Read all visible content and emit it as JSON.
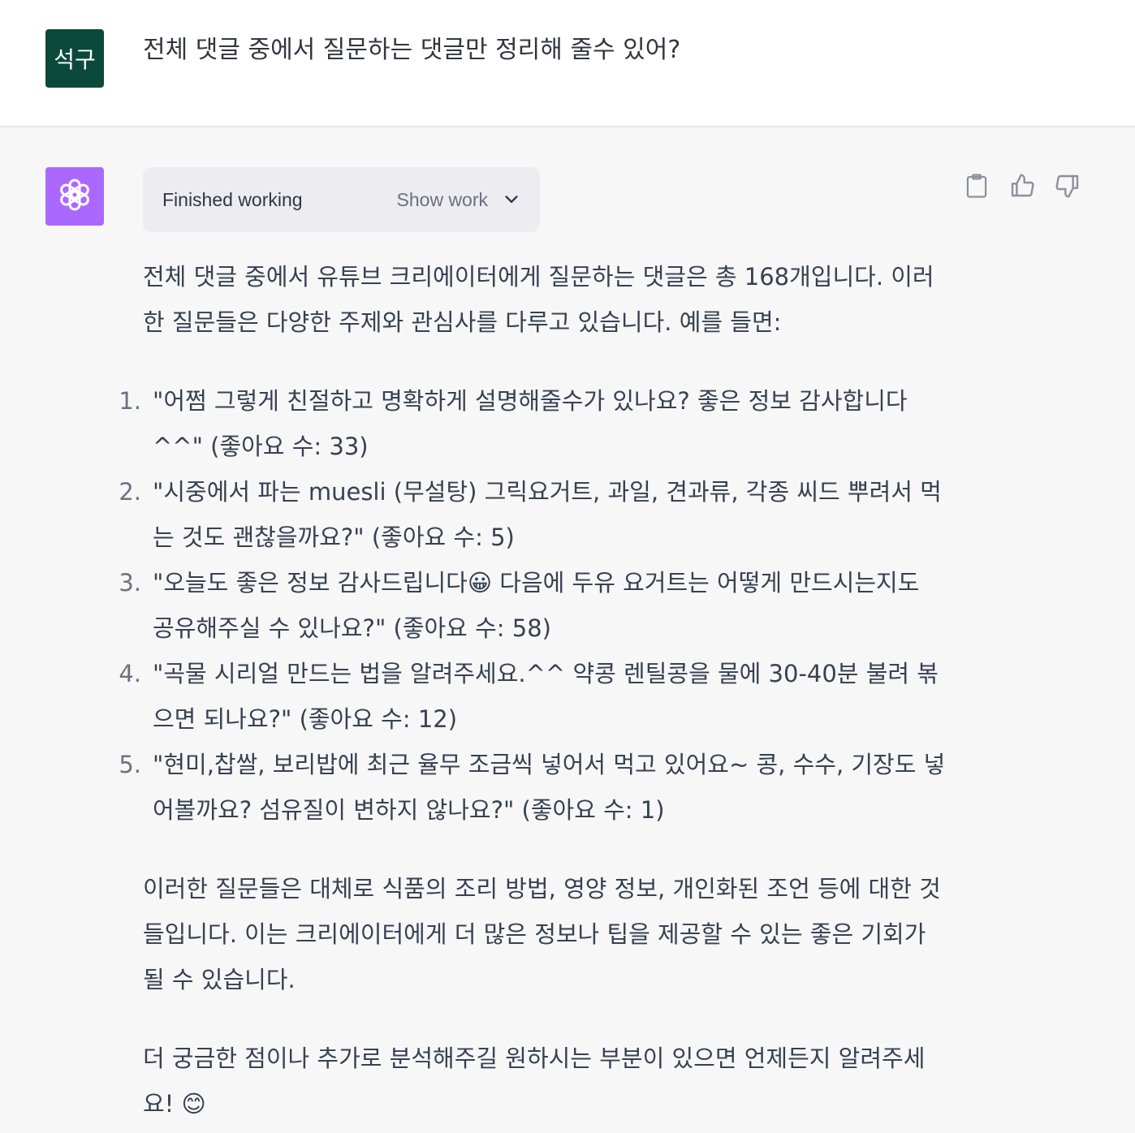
{
  "user_message": {
    "avatar_text": "석구",
    "text": "전체 댓글 중에서 질문하는 댓글만 정리해 줄수 있어?"
  },
  "assistant_message": {
    "work_status": "Finished working",
    "show_work_label": "Show work",
    "intro": "전체 댓글 중에서 유튜브 크리에이터에게 질문하는 댓글은 총 168개입니다. 이러한 질문들은 다양한 주제와 관심사를 다루고 있습니다. 예를 들면:",
    "questions": [
      {
        "num": "1.",
        "text": "\"어쩜 그렇게 친절하고 명확하게 설명해줄수가 있나요? 좋은 정보 감사합니다 ^^\" (좋아요 수: 33)"
      },
      {
        "num": "2.",
        "text": "\"시중에서 파는 muesli (무설탕) 그릭요거트, 과일, 견과류, 각종 씨드 뿌려서 먹는 것도 괜찮을까요?\" (좋아요 수: 5)"
      },
      {
        "num": "3.",
        "text": "\"오늘도 좋은 정보 감사드립니다😀 다음에 두유 요거트는 어떻게 만드시는지도 공유해주실 수 있나요?\" (좋아요 수: 58)"
      },
      {
        "num": "4.",
        "text": "\"곡물 시리얼 만드는 법을 알려주세요.^^ 약콩 렌틸콩을 물에 30-40분 불려 볶으면 되나요?\" (좋아요 수: 12)"
      },
      {
        "num": "5.",
        "text": "\"현미,찹쌀, 보리밥에 최근 율무 조금씩 넣어서 먹고 있어요~ 콩, 수수, 기장도 넣어볼까요? 섬유질이 변하지 않나요?\" (좋아요 수: 1)"
      }
    ],
    "summary": "이러한 질문들은 대체로 식품의 조리 방법, 영양 정보, 개인화된 조언 등에 대한 것들입니다. 이는 크리에이터에게 더 많은 정보나 팁을 제공할 수 있는 좋은 기회가 될 수 있습니다.",
    "closing": "더 궁금한 점이나 추가로 분석해주길 원하시는 부분이 있으면 언제든지 알려주세요! 😊"
  },
  "icons": {
    "bot_avatar": "openai-logo-icon",
    "copy": "clipboard-icon",
    "like": "thumbs-up-icon",
    "dislike": "thumbs-down-icon",
    "expand": "chevron-down-icon"
  },
  "colors": {
    "user_avatar_bg": "#0b4a3a",
    "bot_avatar_bg": "#ab68ff",
    "assistant_bg": "#f7f7f8",
    "work_box_bg": "#ececf1"
  }
}
